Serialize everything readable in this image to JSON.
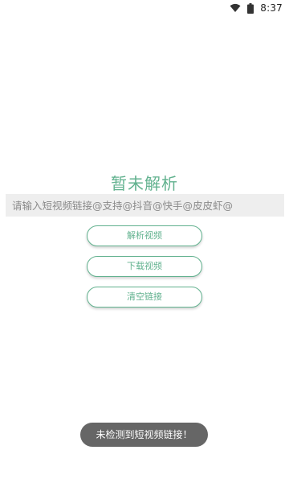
{
  "status_bar": {
    "time": "8:37",
    "icons": [
      "wifi-icon",
      "battery-icon"
    ]
  },
  "main": {
    "title": "暂未解析",
    "link_input": {
      "value": "",
      "placeholder": "请输入短视频链接@支持@抖音@快手@皮皮虾@"
    },
    "buttons": {
      "parse_label": "解析视频",
      "download_label": "下载视频",
      "clear_label": "清空链接"
    }
  },
  "toast": {
    "message": "未检测到短视频链接！"
  },
  "colors": {
    "accent": "#62b28f",
    "input_bg": "#eeeeee",
    "toast_bg": "#666666"
  }
}
